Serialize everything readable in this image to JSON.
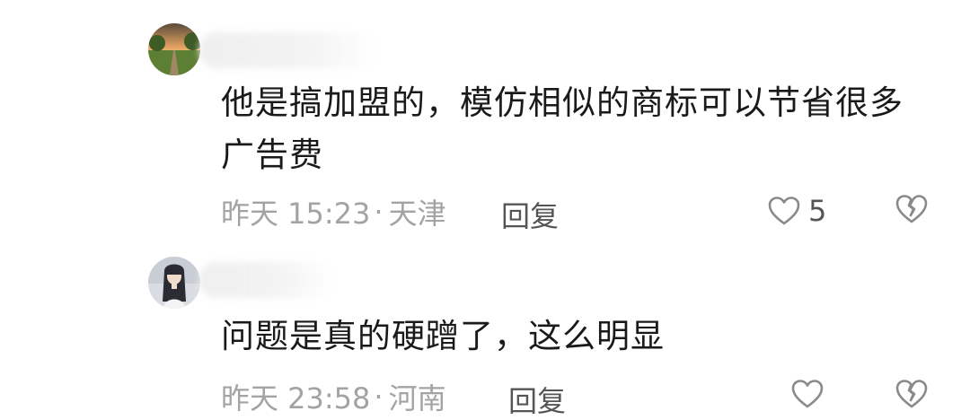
{
  "comments": [
    {
      "text": "他是搞加盟的，模仿相似的商标可以节省很多广告费",
      "time": "昨天 15:23",
      "separator": "·",
      "location": "天津",
      "reply_label": "回复",
      "like_count": "5"
    },
    {
      "text": "问题是真的硬蹭了，这么明显",
      "time": "昨天 23:58",
      "separator": "·",
      "location": "河南",
      "reply_label": "回复",
      "like_count": ""
    }
  ],
  "icons": {
    "like": "heart-outline-icon",
    "dislike": "broken-heart-icon"
  },
  "colors": {
    "text": "#1a1a1a",
    "meta": "#a3a3a3",
    "reply": "#555555",
    "icon": "#8a8a8a"
  }
}
